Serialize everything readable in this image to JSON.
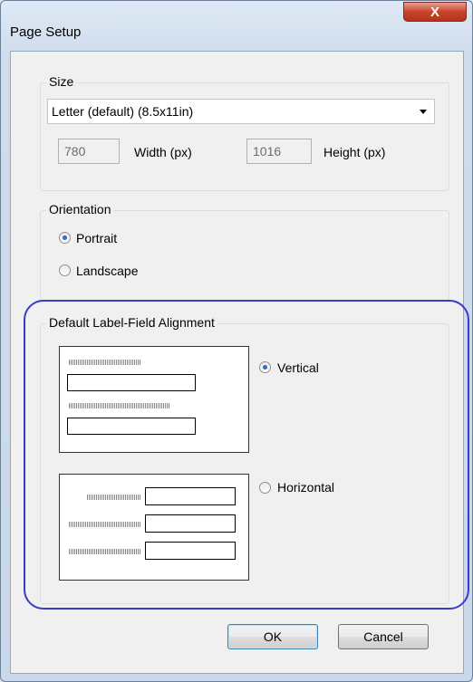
{
  "window": {
    "title": "Page Setup",
    "close_glyph": "X"
  },
  "size_group": {
    "label": "Size",
    "paper_select": "Letter (default) (8.5x11in)",
    "width_value": "780",
    "width_label": "Width (px)",
    "height_value": "1016",
    "height_label": "Height (px)"
  },
  "orientation_group": {
    "label": "Orientation",
    "options": [
      {
        "label": "Portrait",
        "checked": true
      },
      {
        "label": "Landscape",
        "checked": false
      }
    ]
  },
  "alignment_group": {
    "label": "Default Label-Field Alignment",
    "options": [
      {
        "label": "Vertical",
        "checked": true
      },
      {
        "label": "Horizontal",
        "checked": false
      }
    ],
    "highlight_color": "#3a3bc9"
  },
  "buttons": {
    "ok": "OK",
    "cancel": "Cancel"
  }
}
